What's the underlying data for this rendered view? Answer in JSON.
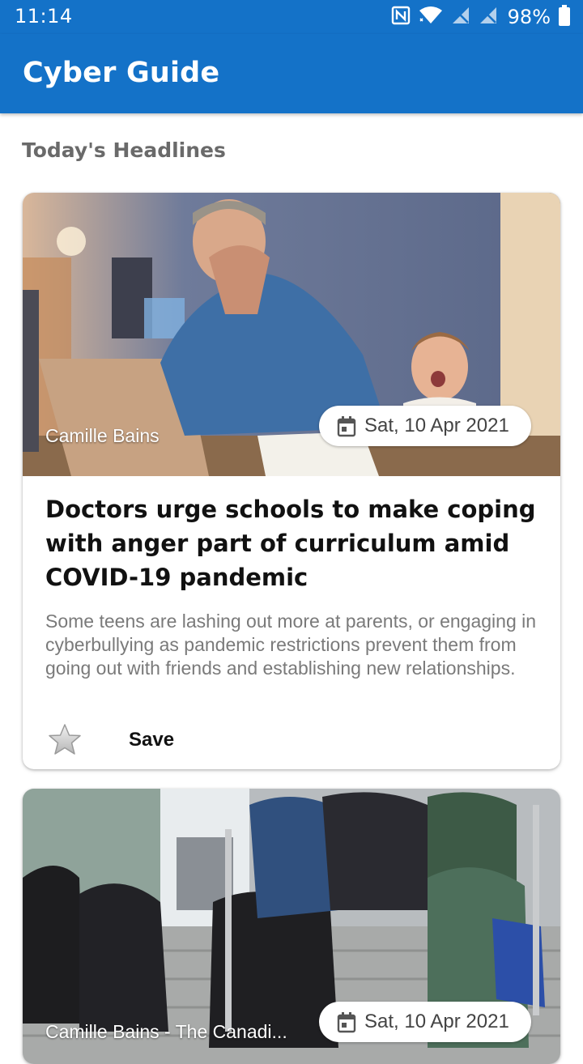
{
  "status_bar": {
    "time": "11:14",
    "battery": "98%",
    "icons": [
      "nfc-icon",
      "wifi-icon",
      "no-signal-icon",
      "no-signal-icon",
      "battery-icon"
    ]
  },
  "app_bar": {
    "title": "Cyber Guide",
    "color": "#1472c8"
  },
  "section": {
    "heading": "Today's Headlines"
  },
  "articles": [
    {
      "author": "Camille Bains",
      "date": "Sat, 10 Apr 2021",
      "title": "Doctors urge schools to make coping with anger part of curriculum amid COVID-19 pandemic",
      "summary": "Some teens are lashing out more at parents, or engaging in cyberbullying as pandemic restrictions prevent them from going out with friends and establishing new relationships.",
      "save_label": "Save"
    },
    {
      "author": "Camille Bains - The Canadi...",
      "date": "Sat, 10 Apr 2021"
    }
  ]
}
